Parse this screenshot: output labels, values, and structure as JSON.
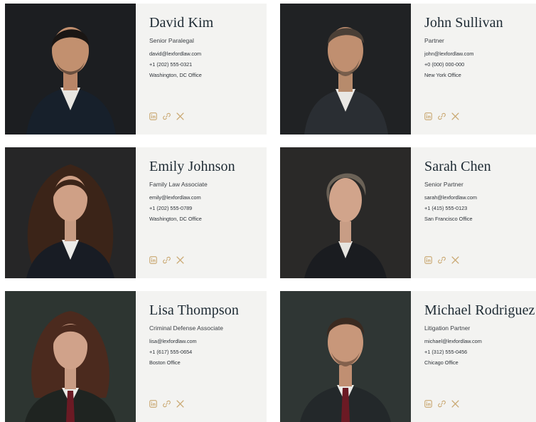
{
  "colors": {
    "accent": "#c9a770",
    "card_bg": "#f3f3f1",
    "name": "#1d2a33"
  },
  "icons": [
    "linkedin-icon",
    "link-icon",
    "x-icon"
  ],
  "people": [
    {
      "name": "David Kim",
      "role": "Senior Paralegal",
      "email": "david@lexfordlaw.com",
      "phone": "+1 (202) 555-0321",
      "office": "Washington, DC Office"
    },
    {
      "name": "John Sullivan",
      "role": "Partner",
      "email": "john@lexfordlaw.com",
      "phone": "+0 (000) 000-000",
      "office": "New York Office"
    },
    {
      "name": "Emily Johnson",
      "role": "Family Law Associate",
      "email": "emily@lexfordlaw.com",
      "phone": "+1 (202) 555-0789",
      "office": "Washington, DC Office"
    },
    {
      "name": "Sarah Chen",
      "role": "Senior Partner",
      "email": "sarah@lexfordlaw.com",
      "phone": "+1 (415) 555-0123",
      "office": "San Francisco Office"
    },
    {
      "name": "Lisa Thompson",
      "role": "Criminal Defense Associate",
      "email": "lisa@lexfordlaw.com",
      "phone": "+1 (617) 555-0654",
      "office": "Boston Office"
    },
    {
      "name": "Michael Rodriguez",
      "role": "Litigation Partner",
      "email": "michael@lexfordlaw.com",
      "phone": "+1 (312) 555-0456",
      "office": "Chicago Office"
    }
  ]
}
